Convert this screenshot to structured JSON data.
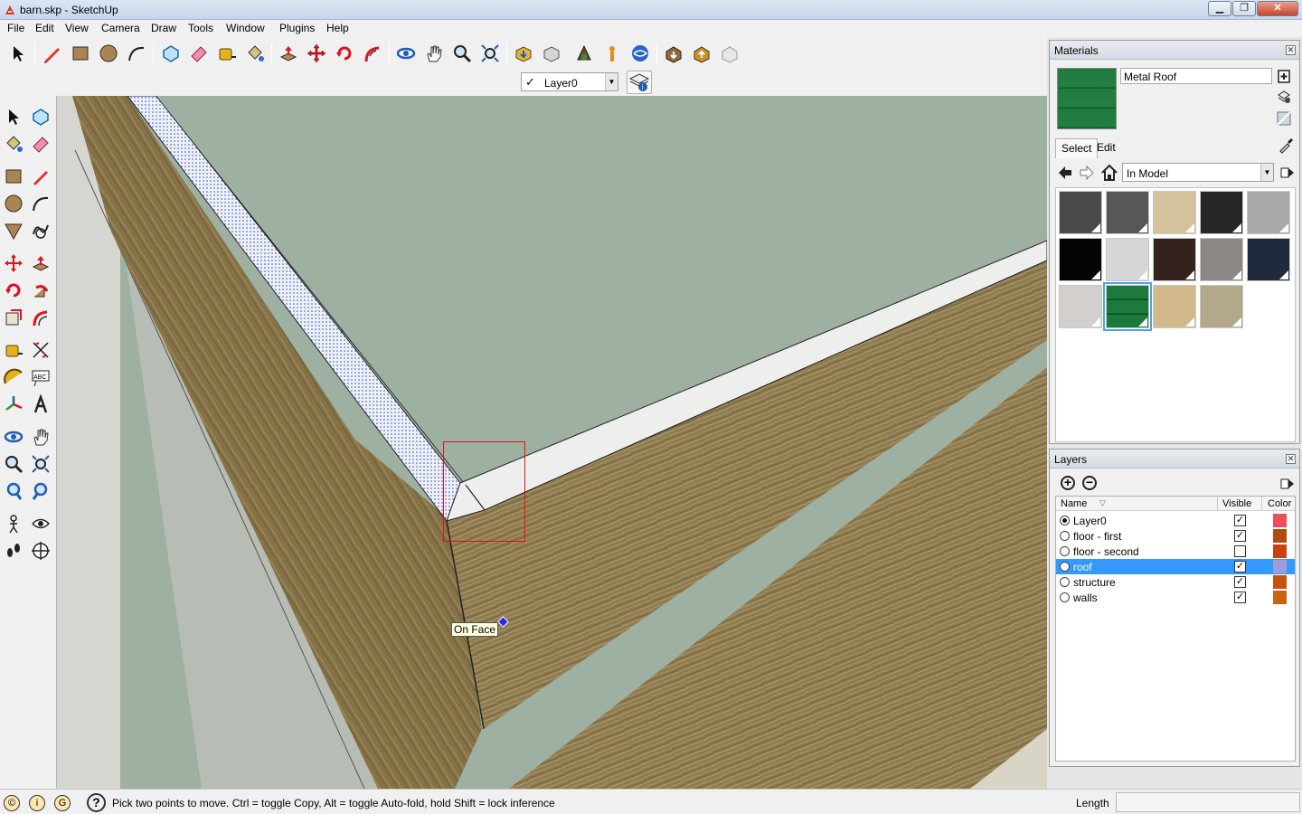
{
  "window": {
    "title": "barn.skp - SketchUp",
    "minimize_label": "▁",
    "maximize_label": "❐",
    "close_label": "✕"
  },
  "menu": {
    "items": [
      {
        "label": "File"
      },
      {
        "label": "Edit"
      },
      {
        "label": "View"
      },
      {
        "label": "Camera"
      },
      {
        "label": "Draw"
      },
      {
        "label": "Tools"
      },
      {
        "label": "Window"
      },
      {
        "label": "Plugins"
      },
      {
        "label": "Help"
      }
    ]
  },
  "toolbar": {
    "icons": [
      "select-icon",
      "pencil-icon",
      "rectangle-icon",
      "circle-icon",
      "arc-icon",
      "make-component-icon",
      "eraser-icon",
      "tape-measure-icon",
      "paint-bucket-icon",
      "push-pull-icon",
      "move-icon",
      "rotate-icon",
      "follow-me-icon",
      "orbit-icon",
      "pan-icon",
      "zoom-icon",
      "zoom-extents-icon",
      "get-models-icon",
      "share-model-icon",
      "share-component-icon",
      "get-photo-texture-icon",
      "preview-earth-icon",
      "3d-warehouse-icon",
      "extension-warehouse-icon",
      "add-location-icon"
    ]
  },
  "layer_toolbar": {
    "current_layer": "Layer0",
    "checkmark": "✓"
  },
  "left_toolbar": {
    "icons": [
      "select-icon",
      "make-component-icon",
      "paint-bucket-icon",
      "eraser-icon",
      "rectangle-icon",
      "line-icon",
      "circle-icon",
      "arc-icon",
      "polygon-icon",
      "freehand-icon",
      "move-icon",
      "push-pull-icon",
      "rotate-icon",
      "follow-me-icon",
      "scale-icon",
      "offset-icon",
      "tape-measure-icon",
      "dimension-icon",
      "protractor-icon",
      "text-icon",
      "axes-icon",
      "3d-text-icon",
      "orbit-icon",
      "pan-icon",
      "zoom-icon",
      "zoom-window-icon",
      "previous-view-icon",
      "zoom-extents-icon",
      "position-camera-icon",
      "look-around-icon",
      "walk-icon",
      "section-plane-icon"
    ]
  },
  "viewport": {
    "tooltip": "On Face"
  },
  "materials_panel": {
    "title": "Materials",
    "current_material": "Metal Roof",
    "tabs": [
      {
        "label": "Select",
        "active": true
      },
      {
        "label": "Edit",
        "active": false
      }
    ],
    "library": "In Model",
    "swatches": [
      {
        "color": "#4a4a4a"
      },
      {
        "color": "#575757"
      },
      {
        "color": "#d5c19b"
      },
      {
        "color": "#262626"
      },
      {
        "color": "#a9a9a9"
      },
      {
        "color": "#050505"
      },
      {
        "color": "#d6d6d6"
      },
      {
        "color": "#33221d"
      },
      {
        "color": "#8c8784"
      },
      {
        "color": "#1f2a3c"
      },
      {
        "color": "#d2cfcc"
      },
      {
        "color": "#1e7a3c",
        "selected": true
      },
      {
        "color": "#d2b98b"
      },
      {
        "color": "#b3a98a"
      }
    ]
  },
  "layers_panel": {
    "title": "Layers",
    "columns": {
      "name": "Name",
      "visible": "Visible",
      "color": "Color"
    },
    "rows": [
      {
        "name": "Layer0",
        "active": true,
        "visible": true,
        "color": "#ee4e5a",
        "selected": false
      },
      {
        "name": "floor - first",
        "active": false,
        "visible": true,
        "color": "#b34a0e",
        "selected": false
      },
      {
        "name": "floor - second",
        "active": false,
        "visible": false,
        "color": "#c9410e",
        "selected": false
      },
      {
        "name": "roof",
        "active": false,
        "visible": true,
        "color": "#9a9fdc",
        "selected": true
      },
      {
        "name": "structure",
        "active": false,
        "visible": true,
        "color": "#c1540e",
        "selected": false
      },
      {
        "name": "walls",
        "active": false,
        "visible": true,
        "color": "#c86311",
        "selected": false
      }
    ]
  },
  "statusbar": {
    "hint": "Pick two points to move.  Ctrl = toggle Copy, Alt = toggle Auto-fold, hold Shift = lock inference",
    "measure_label": "Length",
    "measure_value": "",
    "help_label": "?"
  }
}
